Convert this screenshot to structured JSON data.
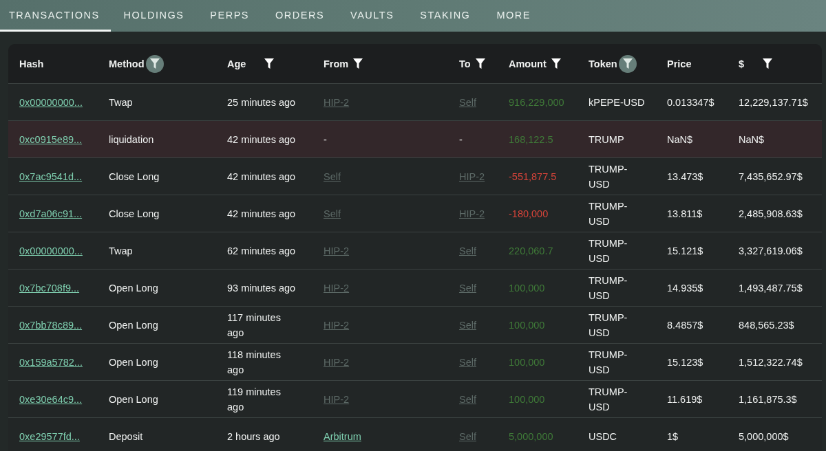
{
  "tabs": [
    {
      "label": "TRANSACTIONS",
      "selected": true
    },
    {
      "label": "HOLDINGS",
      "selected": false
    },
    {
      "label": "PERPS",
      "selected": false
    },
    {
      "label": "ORDERS",
      "selected": false
    },
    {
      "label": "VAULTS",
      "selected": false
    },
    {
      "label": "STAKING",
      "selected": false
    },
    {
      "label": "MORE",
      "selected": false
    }
  ],
  "table": {
    "columns": [
      {
        "label": "Hash",
        "filterable": false
      },
      {
        "label": "Method",
        "filterable": true,
        "filter_active": true
      },
      {
        "label": "Age",
        "filterable": true,
        "filter_active": false
      },
      {
        "label": "From",
        "filterable": true,
        "filter_active": false
      },
      {
        "label": "To",
        "filterable": true,
        "filter_active": false
      },
      {
        "label": "Amount",
        "filterable": true,
        "filter_active": false
      },
      {
        "label": "Token",
        "filterable": true,
        "filter_active": true
      },
      {
        "label": "Price",
        "filterable": false
      },
      {
        "label": "$",
        "filterable": true,
        "filter_active": false
      }
    ],
    "rows": [
      {
        "highlighted": false,
        "hash": "0x00000000...",
        "method": "Twap",
        "age": "25 minutes ago",
        "from": {
          "text": "HIP-2",
          "kind": "muted-link"
        },
        "to": {
          "text": "Self",
          "kind": "muted-link"
        },
        "amount": {
          "text": "916,229,000",
          "kind": "positive"
        },
        "token": "kPEPE-USD",
        "price": "0.013347$",
        "usd": "12,229,137.71$"
      },
      {
        "highlighted": true,
        "hash": "0xc0915e89...",
        "method": "liquidation",
        "age": "42 minutes ago",
        "from": {
          "text": "-",
          "kind": "plain"
        },
        "to": {
          "text": "-",
          "kind": "plain"
        },
        "amount": {
          "text": "168,122.5",
          "kind": "positive"
        },
        "token": "TRUMP",
        "price": "NaN$",
        "usd": "NaN$"
      },
      {
        "highlighted": false,
        "hash": "0x7ac9541d...",
        "method": "Close Long",
        "age": "42 minutes ago",
        "from": {
          "text": "Self",
          "kind": "muted-link"
        },
        "to": {
          "text": "HIP-2",
          "kind": "muted-link"
        },
        "amount": {
          "text": "-551,877.5",
          "kind": "negative"
        },
        "token": "TRUMP-USD",
        "price": "13.473$",
        "usd": "7,435,652.97$"
      },
      {
        "highlighted": false,
        "hash": "0xd7a06c91...",
        "method": "Close Long",
        "age": "42 minutes ago",
        "from": {
          "text": "Self",
          "kind": "muted-link"
        },
        "to": {
          "text": "HIP-2",
          "kind": "muted-link"
        },
        "amount": {
          "text": "-180,000",
          "kind": "negative"
        },
        "token": "TRUMP-USD",
        "price": "13.811$",
        "usd": "2,485,908.63$"
      },
      {
        "highlighted": false,
        "hash": "0x00000000...",
        "method": "Twap",
        "age": "62 minutes ago",
        "from": {
          "text": "HIP-2",
          "kind": "muted-link"
        },
        "to": {
          "text": "Self",
          "kind": "muted-link"
        },
        "amount": {
          "text": "220,060.7",
          "kind": "positive"
        },
        "token": "TRUMP-USD",
        "price": "15.121$",
        "usd": "3,327,619.06$"
      },
      {
        "highlighted": false,
        "hash": "0x7bc708f9...",
        "method": "Open Long",
        "age": "93 minutes ago",
        "from": {
          "text": "HIP-2",
          "kind": "muted-link"
        },
        "to": {
          "text": "Self",
          "kind": "muted-link"
        },
        "amount": {
          "text": "100,000",
          "kind": "positive"
        },
        "token": "TRUMP-USD",
        "price": "14.935$",
        "usd": "1,493,487.75$"
      },
      {
        "highlighted": false,
        "hash": "0x7bb78c89...",
        "method": "Open Long",
        "age": "117 minutes ago",
        "from": {
          "text": "HIP-2",
          "kind": "muted-link"
        },
        "to": {
          "text": "Self",
          "kind": "muted-link"
        },
        "amount": {
          "text": "100,000",
          "kind": "positive"
        },
        "token": "TRUMP-USD",
        "price": "8.4857$",
        "usd": "848,565.23$"
      },
      {
        "highlighted": false,
        "hash": "0x159a5782...",
        "method": "Open Long",
        "age": "118 minutes ago",
        "from": {
          "text": "HIP-2",
          "kind": "muted-link"
        },
        "to": {
          "text": "Self",
          "kind": "muted-link"
        },
        "amount": {
          "text": "100,000",
          "kind": "positive"
        },
        "token": "TRUMP-USD",
        "price": "15.123$",
        "usd": "1,512,322.74$"
      },
      {
        "highlighted": false,
        "hash": "0xe30e64c9...",
        "method": "Open Long",
        "age": "119 minutes ago",
        "from": {
          "text": "HIP-2",
          "kind": "muted-link"
        },
        "to": {
          "text": "Self",
          "kind": "muted-link"
        },
        "amount": {
          "text": "100,000",
          "kind": "positive"
        },
        "token": "TRUMP-USD",
        "price": "11.619$",
        "usd": "1,161,875.3$"
      },
      {
        "highlighted": false,
        "hash": "0xe29577fd...",
        "method": "Deposit",
        "age": "2 hours ago",
        "from": {
          "text": "Arbitrum",
          "kind": "link"
        },
        "to": {
          "text": "Self",
          "kind": "muted-link"
        },
        "amount": {
          "text": "5,000,000",
          "kind": "positive"
        },
        "token": "USDC",
        "price": "1$",
        "usd": "5,000,000$"
      }
    ]
  }
}
